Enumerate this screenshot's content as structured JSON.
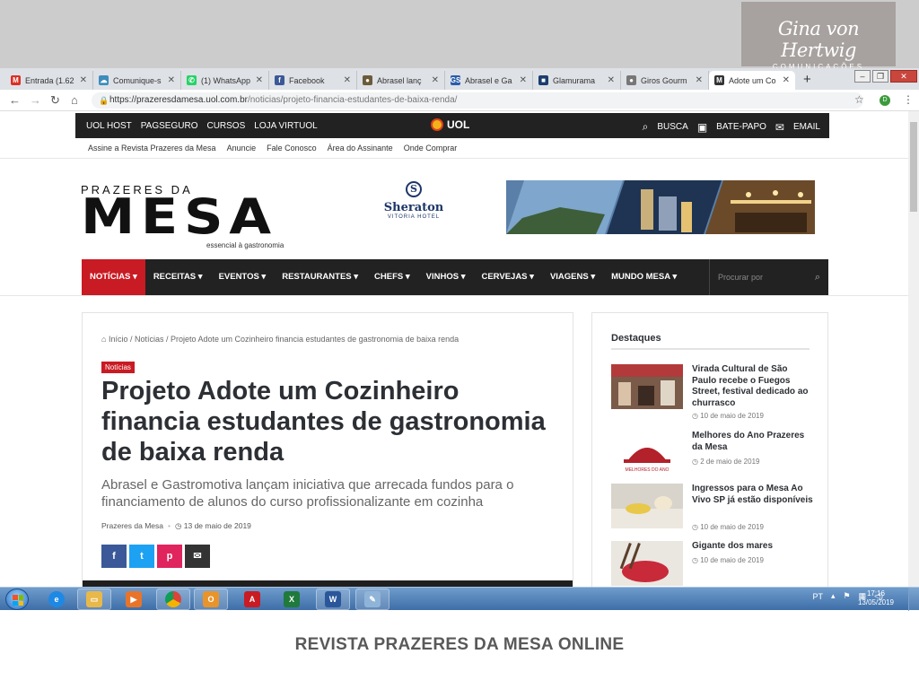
{
  "brand_corner": {
    "signature": "Gina von Hertwig",
    "subtitle": "COMUNICAÇÕES"
  },
  "browser": {
    "tabs": [
      {
        "title": "Entrada (1.62",
        "icon": "gmail-icon",
        "color": "#d93025",
        "glyph": "M"
      },
      {
        "title": "Comunique-s",
        "icon": "cloud-icon",
        "color": "#3c8dbc",
        "glyph": "☁"
      },
      {
        "title": "(1) WhatsApp",
        "icon": "whatsapp-icon",
        "color": "#25d366",
        "glyph": "✆"
      },
      {
        "title": "Facebook",
        "icon": "facebook-icon",
        "color": "#3b5998",
        "glyph": "f"
      },
      {
        "title": "Abrasel lanç",
        "icon": "globe-icon",
        "color": "#6b5b3a",
        "glyph": "●"
      },
      {
        "title": "Abrasel e Ga",
        "icon": "gs-icon",
        "color": "#2a5caa",
        "glyph": "GS"
      },
      {
        "title": "Glamurama",
        "icon": "glamurama-icon",
        "color": "#1a3d6e",
        "glyph": "■"
      },
      {
        "title": "Giros Gourm",
        "icon": "globe-icon",
        "color": "#777777",
        "glyph": "●"
      },
      {
        "title": "Adote um Co",
        "icon": "gmail-icon",
        "color": "#333333",
        "glyph": "M",
        "active": true
      }
    ],
    "url_host": "https://prazeresdamesa.uol.com.br",
    "url_path": "/noticias/projeto-financia-estudantes-de-baixa-renda/",
    "profile_initial": "D"
  },
  "site": {
    "uol_links": [
      "UOL HOST",
      "PAGSEGURO",
      "CURSOS",
      "LOJA VIRTUOL"
    ],
    "uol_logo": "UOL",
    "uol_right": {
      "busca": "BUSCA",
      "batepapo": "BATE-PAPO",
      "email": "EMAIL"
    },
    "sublinks": [
      "Assine a Revista Prazeres da Mesa",
      "Anuncie",
      "Fale Conosco",
      "Área do Assinante",
      "Onde Comprar"
    ],
    "logo_top": "PRAZERES DA",
    "logo_big": "MESA",
    "logo_tag": "essencial à gastronomia",
    "sponsor": {
      "letter": "S",
      "name": "Sheraton",
      "sub": "VITORIA HOTEL"
    },
    "nav": [
      "NOTÍCIAS ▾",
      "RECEITAS ▾",
      "EVENTOS ▾",
      "RESTAURANTES ▾",
      "CHEFS ▾",
      "VINHOS ▾",
      "CERVEJAS ▾",
      "VIAGENS ▾",
      "MUNDO MESA ▾"
    ],
    "search_placeholder": "Procurar por"
  },
  "article": {
    "breadcrumb": "Início / Notícias / Projeto Adote um Cozinheiro financia estudantes de gastronomia de baixa renda",
    "category": "Notícias",
    "title": "Projeto Adote um Cozinheiro financia estudantes de gastronomia de baixa renda",
    "lead": "Abrasel e Gastromotiva lançam iniciativa que arrecada fundos para o financiamento de alunos do curso profissionalizante em cozinha",
    "author": "Prazeres da Mesa",
    "date": "13 de maio de 2019",
    "share_colors": [
      "#3b5998",
      "#1da1f2",
      "#e0245e",
      "#333333"
    ]
  },
  "sidebar": {
    "title": "Destaques",
    "items": [
      {
        "text": "Virada Cultural de São Paulo recebe o Fuegos Street, festival dedicado ao churrasco",
        "date": "10 de maio de 2019"
      },
      {
        "text": "Melhores do Ano Prazeres da Mesa",
        "date": "2 de maio de 2019"
      },
      {
        "text": "Ingressos para o Mesa Ao Vivo SP já estão disponíveis",
        "date": "10 de maio de 2019"
      },
      {
        "text": "Gigante dos mares",
        "date": "10 de maio de 2019"
      }
    ],
    "thumb2_text": "MELHORES DO ANO"
  },
  "taskbar": {
    "lang": "PT",
    "time": "17:16",
    "date": "13/05/2019"
  },
  "caption": "REVISTA PRAZERES DA MESA ONLINE"
}
